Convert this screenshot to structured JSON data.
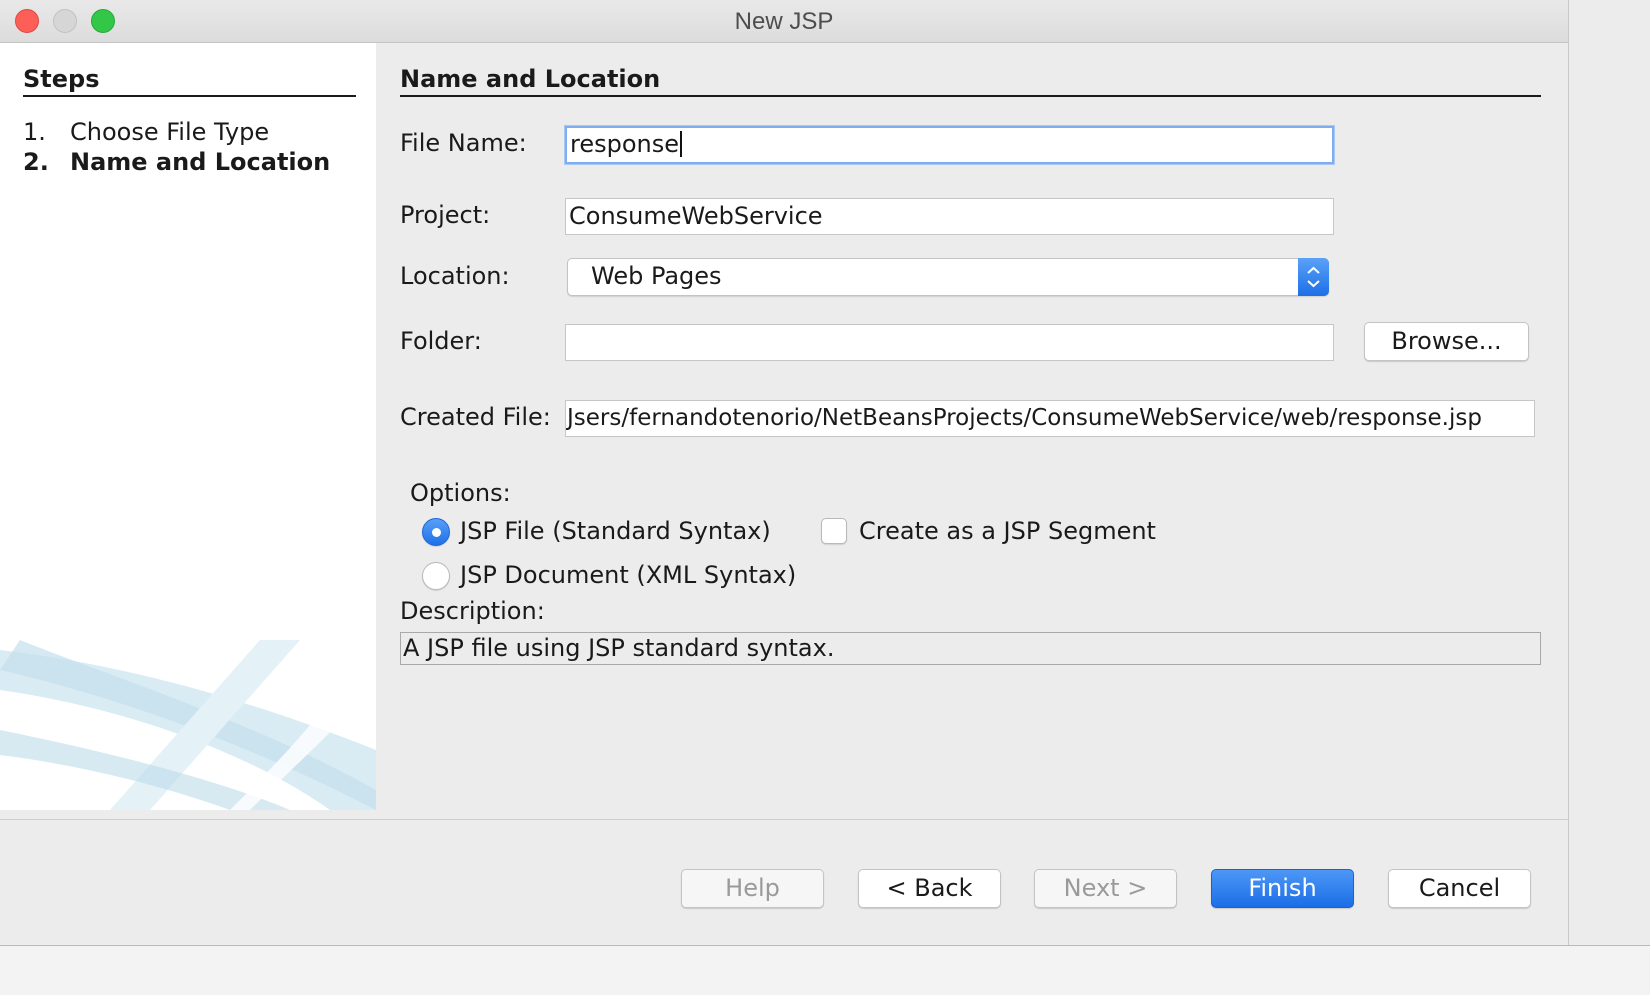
{
  "window": {
    "title": "New JSP"
  },
  "steps": {
    "heading": "Steps",
    "items": [
      {
        "num": "1.",
        "label": "Choose File Type"
      },
      {
        "num": "2.",
        "label": "Name and Location"
      }
    ]
  },
  "form": {
    "heading": "Name and Location",
    "file_name": {
      "label": "File Name:",
      "value": "response"
    },
    "project": {
      "label": "Project:",
      "value": "ConsumeWebService"
    },
    "location": {
      "label": "Location:",
      "value": "Web Pages"
    },
    "folder": {
      "label": "Folder:",
      "value": "",
      "browse_label": "Browse..."
    },
    "created_file": {
      "label": "Created File:",
      "value": "Jsers/fernandotenorio/NetBeansProjects/ConsumeWebService/web/response.jsp"
    },
    "options": {
      "label": "Options:",
      "jsp_file": "JSP File (Standard Syntax)",
      "jsp_document": "JSP Document (XML Syntax)",
      "segment": "Create as a JSP Segment"
    },
    "description": {
      "label": "Description:",
      "value": "A JSP file using JSP standard syntax."
    }
  },
  "buttons": {
    "help": "Help",
    "back": "< Back",
    "next": "Next >",
    "finish": "Finish",
    "cancel": "Cancel"
  },
  "colors": {
    "accent": "#1c6fe6",
    "focus_ring": "#7eaef0"
  }
}
